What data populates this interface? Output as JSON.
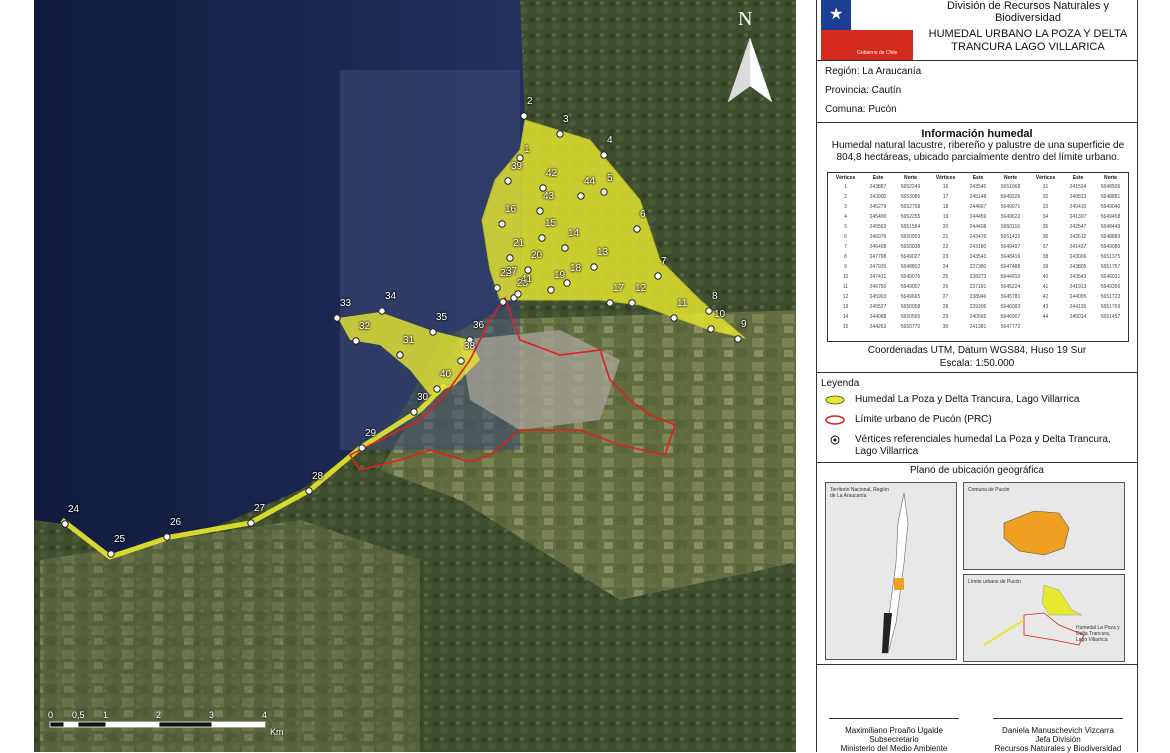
{
  "map": {
    "north_label": "N",
    "scale_labels": [
      "0",
      "0,5",
      "1",
      "2",
      "3",
      "4"
    ],
    "scale_unit": "Km",
    "vertex_labels": [
      "1",
      "2",
      "3",
      "4",
      "5",
      "6",
      "7",
      "8",
      "9",
      "10",
      "11",
      "12",
      "13",
      "14",
      "15",
      "16",
      "17",
      "18",
      "19",
      "20",
      "21",
      "22",
      "23",
      "24",
      "25",
      "26",
      "27",
      "28",
      "29",
      "30",
      "31",
      "32",
      "33",
      "34",
      "35",
      "36",
      "37",
      "38",
      "39",
      "40",
      "41",
      "42",
      "43",
      "44"
    ],
    "colors": {
      "wetland": "#e8e830",
      "urban_limit": "#e02020",
      "lake": "#1a2a5a",
      "vegetation": "#3d4a2e"
    }
  },
  "header": {
    "gov_logo_text": "Gobierno de Chile",
    "division": "División de Recursos Naturales y Biodiversidad",
    "title_line1": "HUMEDAL URBANO LA POZA Y DELTA",
    "title_line2": "TRANCURA LAGO VILLARICA"
  },
  "admin": {
    "region": "Región: La Araucanía",
    "provincia": "Provincia: Cautín",
    "comuna": "Comuna: Pucón"
  },
  "info": {
    "title": "Información humedal",
    "description": "Humedal natural lacustre, ribereño y palustre de una superficie de 804,8 hectáreas, ubicado parcialmente dentro del límite urbano.",
    "table_headers": [
      "Vértices",
      "Este",
      "Norte",
      "Vértices",
      "Este",
      "Norte",
      "Vértices",
      "Este",
      "Norte"
    ],
    "table_rows": [
      [
        "1",
        "243887",
        "5652249",
        "16",
        "243545",
        "5651068",
        "31",
        "241534",
        "5648506"
      ],
      [
        "2",
        "243900",
        "5653085",
        "17",
        "245148",
        "5649326",
        "32",
        "240813",
        "5648881"
      ],
      [
        "3",
        "245279",
        "5652758",
        "18",
        "244667",
        "5649971",
        "33",
        "240410",
        "5649040"
      ],
      [
        "4",
        "245400",
        "5652255",
        "19",
        "244459",
        "5649622",
        "34",
        "241307",
        "5649458"
      ],
      [
        "5",
        "245563",
        "5651584",
        "20",
        "244408",
        "5650116",
        "35",
        "242547",
        "5648449"
      ],
      [
        "6",
        "246076",
        "5650953",
        "21",
        "243476",
        "5651432",
        "36",
        "242612",
        "5648889"
      ],
      [
        "7",
        "246408",
        "5650038",
        "22",
        "243180",
        "5649497",
        "37",
        "241437",
        "5649089"
      ],
      [
        "8",
        "247798",
        "5649027",
        "23",
        "243543",
        "5648416",
        "38",
        "243006",
        "5651375"
      ],
      [
        "9",
        "247935",
        "5648802",
        "24",
        "237380",
        "5647488",
        "39",
        "243805",
        "5651757"
      ],
      [
        "10",
        "247431",
        "5649076",
        "25",
        "238273",
        "5644910",
        "40",
        "243543",
        "5646031"
      ],
      [
        "11",
        "246750",
        "5649007",
        "26",
        "237191",
        "5645224",
        "41",
        "241913",
        "5649356"
      ],
      [
        "12",
        "245903",
        "5649665",
        "27",
        "238946",
        "5645781",
        "42",
        "244005",
        "5651723"
      ],
      [
        "13",
        "245527",
        "5650058",
        "28",
        "239306",
        "5646093",
        "43",
        "244135",
        "5651769"
      ],
      [
        "14",
        "244068",
        "5650565",
        "29",
        "240565",
        "5646907",
        "44",
        "245014",
        "5651457"
      ],
      [
        "15",
        "244263",
        "5650770",
        "30",
        "241381",
        "5647772",
        "",
        "",
        ""
      ]
    ],
    "coords_line1": "Coordenadas UTM, Datum WGS84, Huso 19 Sur",
    "coords_line2": "Escala: 1:50.000"
  },
  "legend": {
    "title": "Leyenda",
    "item_wetland": "Humedal La Poza y Delta Trancura, Lago Villarrica",
    "item_urban": "Límite urbano de Pucón (PRC)",
    "item_vertices": "Vértices referenciales humedal La Poza y Delta Trancura, Lago Villarrica"
  },
  "location": {
    "title": "Plano de ubicación geográfica",
    "inset1_label": "Territorio Nacional, Región de La Araucanía",
    "inset2_label": "Comuna de Pucón",
    "inset3_label": "Límite urbano de Pucón",
    "inset3_sublabel": "Humedal La Poza y Delta Trancura, Lago Villarrica"
  },
  "signatures": {
    "left_name": "Maximiliano Proaño Ugalde",
    "left_role": "Subsecretario",
    "left_org": "Ministerio del Medio Ambiente",
    "right_name": "Daniela Manuschevich Vizcarra",
    "right_role": "Jefa División",
    "right_org": "Recursos Naturales y Biodiversidad"
  }
}
